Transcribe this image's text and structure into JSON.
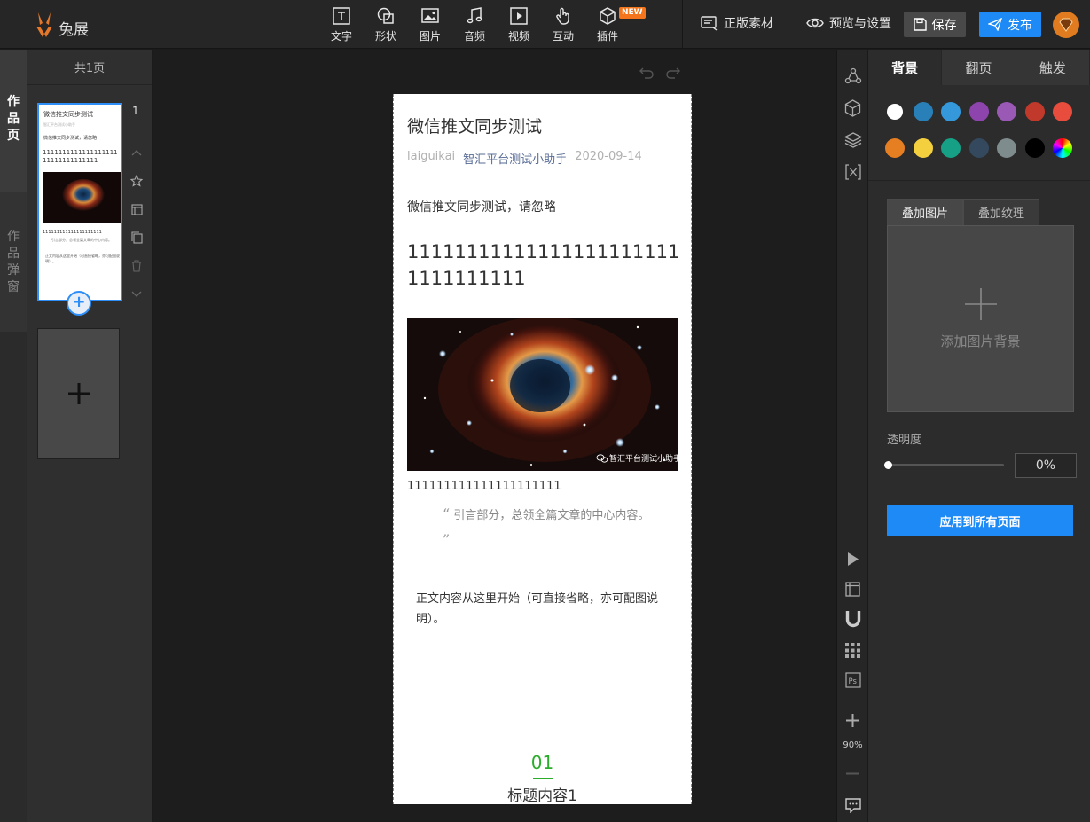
{
  "app": {
    "logo_text": "兔展"
  },
  "toolbar": {
    "tools": [
      {
        "label": "文字",
        "icon": "text-icon"
      },
      {
        "label": "形状",
        "icon": "shape-icon"
      },
      {
        "label": "图片",
        "icon": "image-icon"
      },
      {
        "label": "音频",
        "icon": "audio-icon"
      },
      {
        "label": "视频",
        "icon": "video-icon"
      },
      {
        "label": "互动",
        "icon": "interact-icon"
      },
      {
        "label": "插件",
        "icon": "plugin-icon"
      }
    ],
    "new_badge": "NEW",
    "material_label": "正版素材",
    "preview_label": "预览与设置",
    "save_label": "保存",
    "publish_label": "发布"
  },
  "left_tabs": {
    "works_page": [
      "作",
      "品",
      "页"
    ],
    "works_popup": [
      "作",
      "品",
      "弹",
      "窗"
    ]
  },
  "pages_panel": {
    "header": "共1页",
    "page_number": "1"
  },
  "article": {
    "title": "微信推文同步测试",
    "meta_user": "laiguikai",
    "meta_author": "智汇平台测试小助手",
    "meta_date": "2020-09-14",
    "intro": "微信推文同步测试，请忽略",
    "ones_block": "111111111111111111111111111111111",
    "image_watermark": "智汇平台测试小助手",
    "ones_line": "111111111111111111111",
    "quote": "引言部分，总领全篇文章的中心内容。",
    "body": "正文内容从这里开始（可直接省略，亦可配图说明）。",
    "section_number": "01",
    "section_heading": "标题内容1"
  },
  "right_strip": {
    "zoom_level": "90%"
  },
  "properties": {
    "tabs": [
      "背景",
      "翻页",
      "触发"
    ],
    "colors": [
      "#ffffff",
      "#2980b9",
      "#3498db",
      "#8e44ad",
      "#9b59b6",
      "#c0392b",
      "#e74c3c",
      "#e67e22",
      "#f4d03f",
      "#16a085",
      "#34495e",
      "#7f8c8d",
      "#000000",
      "rainbow"
    ],
    "sub_tabs": [
      "叠加图片",
      "叠加纹理"
    ],
    "add_bg_label": "添加图片背景",
    "opacity_label": "透明度",
    "opacity_value": "0%",
    "opacity": 0,
    "apply_label": "应用到所有页面"
  },
  "accent_color": "#1e8af5"
}
